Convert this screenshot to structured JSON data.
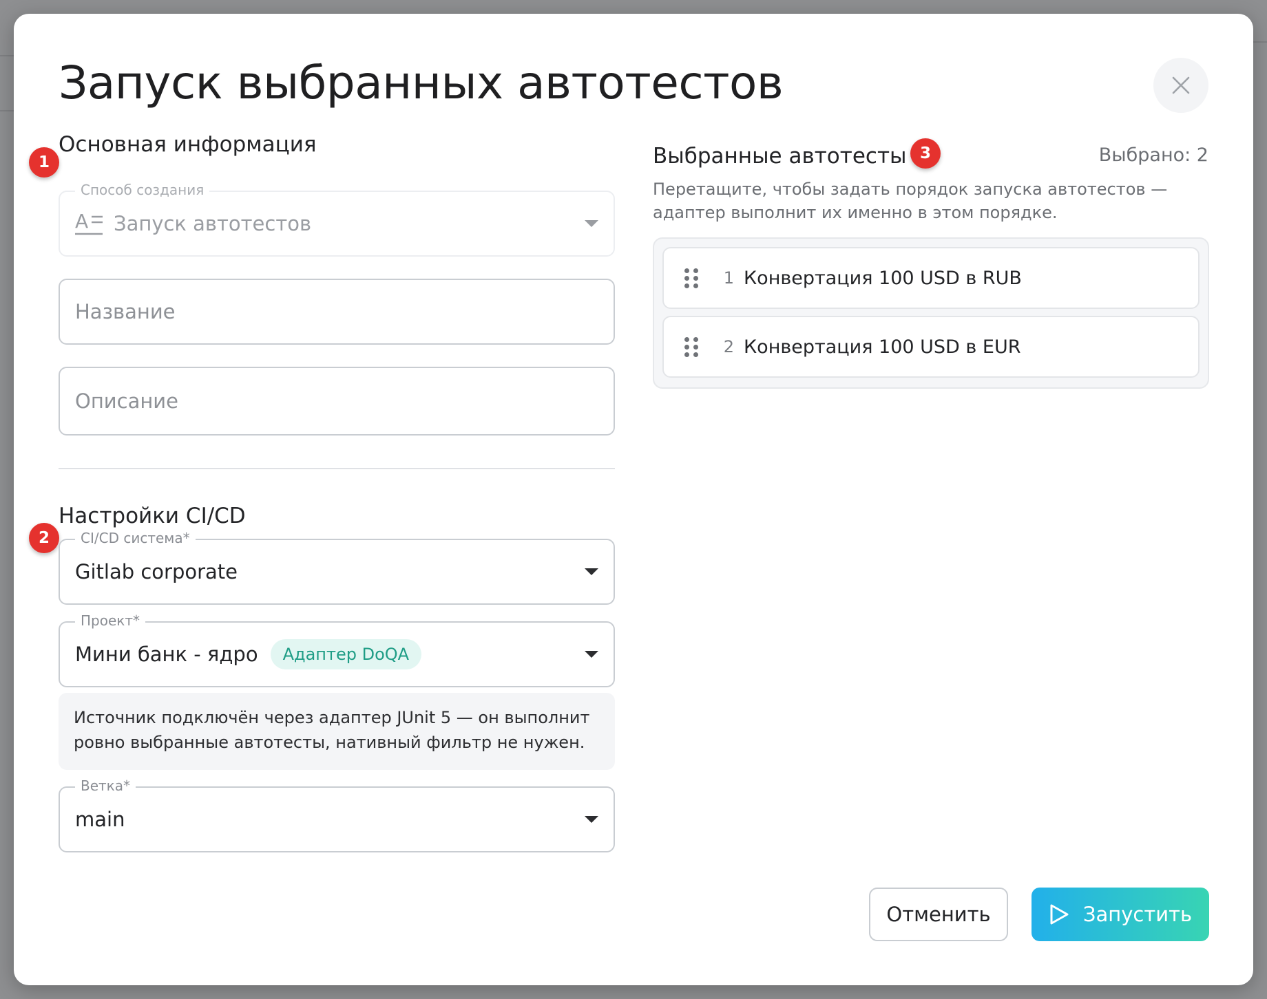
{
  "dialog": {
    "title": "Запуск выбранных автотестов"
  },
  "left": {
    "section_main": "Основная информация",
    "creation_method": {
      "legend": "Способ создания",
      "value": "Запуск автотестов",
      "icon": "text-format-icon"
    },
    "name_placeholder": "Название",
    "description_placeholder": "Описание",
    "section_cicd": "Настройки CI/CD",
    "cicd_system": {
      "legend": "CI/CD система*",
      "value": "Gitlab corporate"
    },
    "project": {
      "legend": "Проект*",
      "value": "Мини банк - ядро",
      "tag": "Адаптер DoQA"
    },
    "info_text": "Источник подключён через адаптер JUnit 5 — он выполнит ровно выбранные автотесты, нативный фильтр не нужен.",
    "branch": {
      "legend": "Ветка*",
      "value": "main"
    }
  },
  "right": {
    "section_title": "Выбранные автотесты",
    "selected_count": "Выбрано: 2",
    "hint": "Перетащите, чтобы задать порядок запуска автотестов — адаптер выполнит их именно в этом порядке.",
    "items": [
      {
        "index": "1",
        "label": "Конвертация 100 USD в RUB"
      },
      {
        "index": "2",
        "label": "Конвертация 100 USD в EUR"
      }
    ]
  },
  "badges": [
    "1",
    "2",
    "3"
  ],
  "buttons": {
    "cancel": "Отменить",
    "run": "Запустить"
  },
  "colors": {
    "accent_from": "#22b0ea",
    "accent_to": "#38d4b3",
    "badge": "#e5322e",
    "tag_text": "#1f9d86",
    "tag_bg": "#e2f6f2"
  }
}
